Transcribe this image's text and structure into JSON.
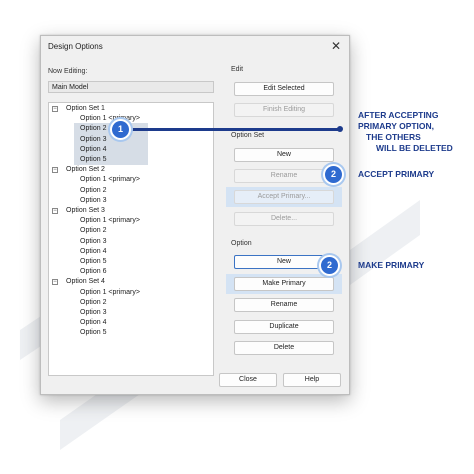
{
  "dialog": {
    "title": "Design Options",
    "close_glyph": "✕",
    "now_editing_label": "Now Editing:",
    "current_value": "Main Model"
  },
  "tree": {
    "sets": [
      {
        "label": "Option Set 1",
        "options": [
          "Option 1 <primary>",
          "Option 2",
          "Option 3",
          "Option 4",
          "Option 5"
        ]
      },
      {
        "label": "Option Set 2",
        "options": [
          "Option 1 <primary>",
          "Option 2",
          "Option 3"
        ]
      },
      {
        "label": "Option Set 3",
        "options": [
          "Option 1 <primary>",
          "Option 2",
          "Option 3",
          "Option 4",
          "Option 5",
          "Option 6"
        ]
      },
      {
        "label": "Option Set 4",
        "options": [
          "Option 1 <primary>",
          "Option 2",
          "Option 3",
          "Option 4",
          "Option 5"
        ]
      }
    ],
    "expander_glyph": "−"
  },
  "edit": {
    "label": "Edit",
    "edit_selected": "Edit Selected",
    "finish_editing": "Finish Editing"
  },
  "option_set": {
    "label": "Option Set",
    "new": "New",
    "rename": "Rename",
    "accept_primary": "Accept Primary...",
    "delete": "Delete..."
  },
  "option": {
    "label": "Option",
    "new": "New",
    "make_primary": "Make Primary",
    "rename": "Rename",
    "duplicate": "Duplicate",
    "delete": "Delete"
  },
  "footer": {
    "close": "Close",
    "help": "Help"
  },
  "annotations": {
    "badge1": "1",
    "badge2a": "2",
    "badge2b": "2",
    "note1": [
      "AFTER ACCEPTING",
      "PRIMARY OPTION,",
      "THE OTHERS",
      "WILL BE DELETED"
    ],
    "note2": "ACCEPT PRIMARY",
    "note3": "MAKE PRIMARY"
  },
  "colors": {
    "accent": "#2f6ad0",
    "annotation_text": "#1d3b8c",
    "selection": "#d6dde6",
    "highlight_band": "#cfe1f4"
  }
}
